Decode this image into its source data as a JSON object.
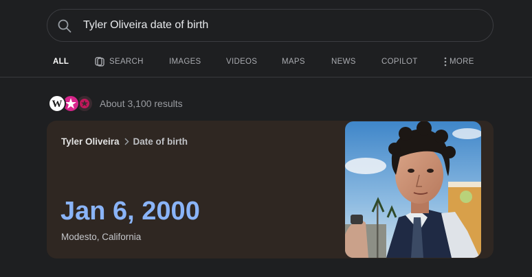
{
  "search": {
    "query": "Tyler Oliveira date of birth"
  },
  "tabs": [
    {
      "label": "ALL",
      "active": true
    },
    {
      "label": "SEARCH",
      "icon": "copilot-search-icon"
    },
    {
      "label": "IMAGES"
    },
    {
      "label": "VIDEOS"
    },
    {
      "label": "MAPS"
    },
    {
      "label": "NEWS"
    },
    {
      "label": "COPILOT"
    },
    {
      "label": "MORE",
      "icon": "more-vertical-icon"
    }
  ],
  "results": {
    "count_text": "About 3,100 results",
    "sources": [
      {
        "icon": "wikipedia-icon",
        "letter": "W",
        "color": "#ffffff"
      },
      {
        "icon": "star-source-icon",
        "color": "#d7258b"
      },
      {
        "icon": "star-badge-source-icon",
        "color": "#c2185b"
      }
    ]
  },
  "answer_card": {
    "entity": "Tyler Oliveira",
    "attribute": "Date of birth",
    "value": "Jan 6, 2000",
    "place": "Modesto, California",
    "image": "portrait-photo",
    "colors": {
      "card_bg": "#2f2722",
      "answer": "#8ab4f8"
    }
  }
}
